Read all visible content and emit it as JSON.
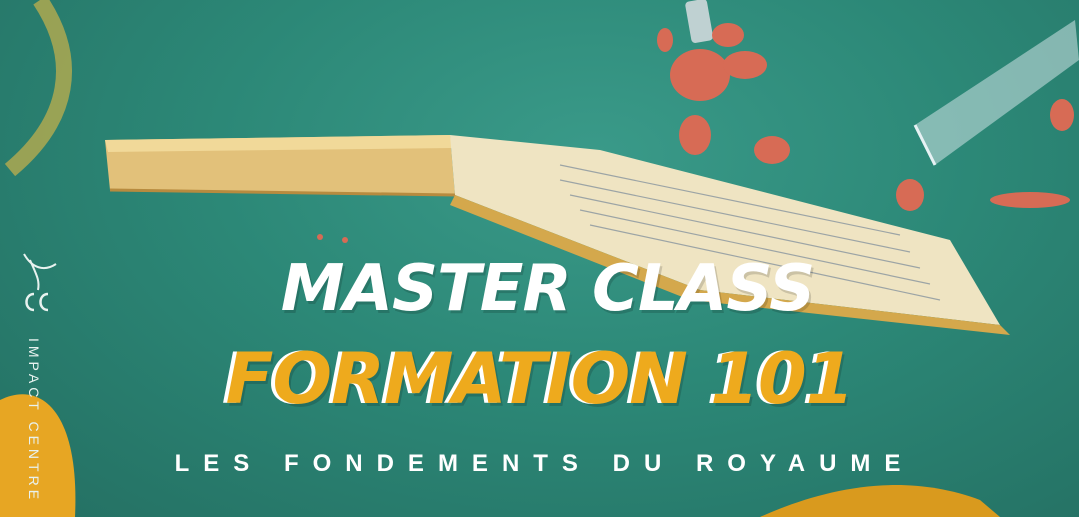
{
  "poster": {
    "title": "MASTER CLASS",
    "subtitle": "FORMATION 101",
    "tagline": "LES FONDEMENTS DU ROYAUME",
    "side_text": "IMPACT CENTRE",
    "logo_letters": "ICC"
  },
  "colors": {
    "background": "#2a8576",
    "accent_yellow": "#eeaa1d",
    "text_white": "#ffffff"
  },
  "illustration": {
    "main_object": "open-book-icon",
    "decorations": [
      "glass-tube-icon",
      "red-blobs-decoration",
      "yellow-shapes-decoration"
    ]
  }
}
